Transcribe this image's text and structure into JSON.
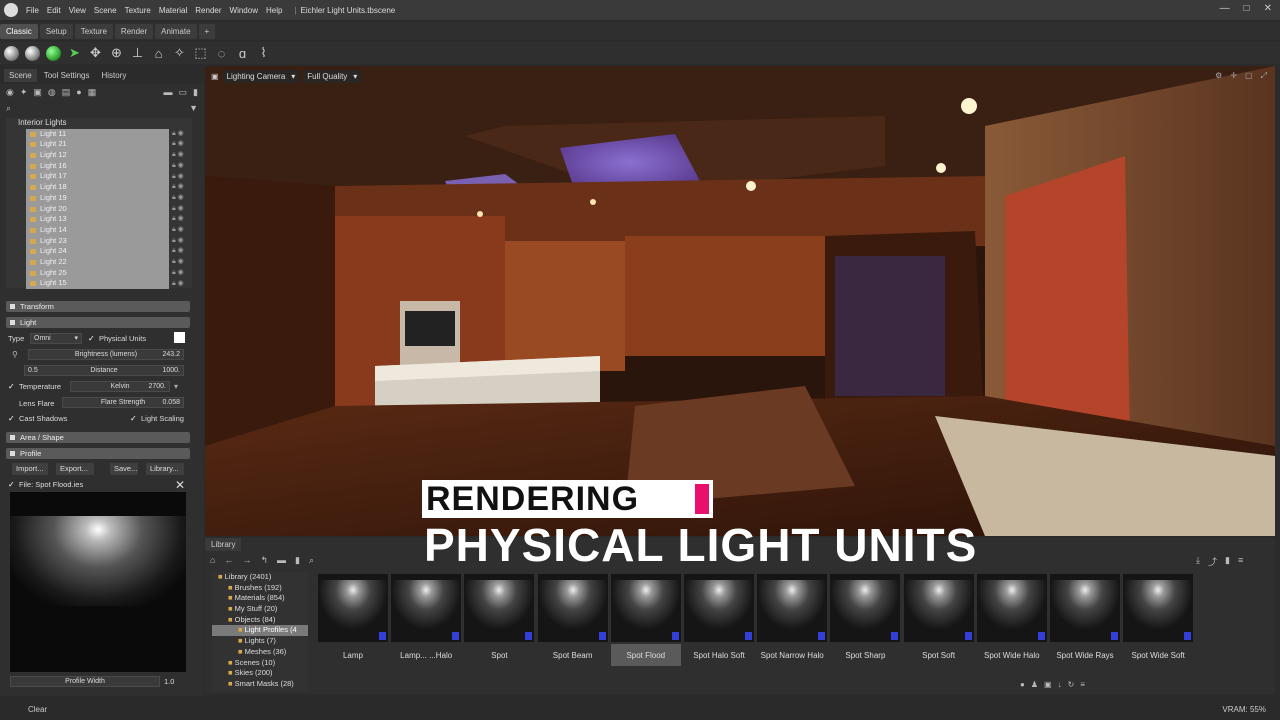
{
  "window": {
    "title": "Eichler Light Units.tbscene",
    "menu": [
      "File",
      "Edit",
      "View",
      "Scene",
      "Texture",
      "Material",
      "Render",
      "Window",
      "Help"
    ],
    "controls": [
      "—",
      "□",
      "✕"
    ]
  },
  "tabs": [
    {
      "label": "Classic",
      "active": true
    },
    {
      "label": "Setup",
      "active": false
    },
    {
      "label": "Texture",
      "active": false
    },
    {
      "label": "Render",
      "active": false
    },
    {
      "label": "Animate",
      "active": false
    },
    {
      "label": "+",
      "active": false
    }
  ],
  "left_panel": {
    "tabs": [
      "Scene",
      "Tool Settings",
      "History"
    ],
    "tree_root": "Interior Lights",
    "tree_items": [
      "Light 11",
      "Light 21",
      "Light 12",
      "Light 16",
      "Light 17",
      "Light 18",
      "Light 19",
      "Light 20",
      "Light 13",
      "Light 14",
      "Light 23",
      "Light 24",
      "Light 22",
      "Light 25",
      "Light 15"
    ],
    "sections": {
      "transform": "Transform",
      "light": "Light",
      "area": "Area / Shape",
      "profile": "Profile"
    },
    "light": {
      "type_label": "Type",
      "type_value": "Omni",
      "physical_units": "Physical Units",
      "brightness_label": "Brightness (lumens)",
      "brightness_value": "243.2",
      "distance_min": "0.5",
      "distance_label": "Distance",
      "distance_value": "1000.",
      "temperature_label": "Temperature",
      "kelvin_label": "Kelvin",
      "kelvin_value": "2700.",
      "lens_flare": "Lens Flare",
      "flare_strength_label": "Flare Strength",
      "flare_strength_value": "0.058",
      "cast_shadows": "Cast Shadows",
      "light_scaling": "Light Scaling"
    },
    "profile": {
      "buttons": [
        "Import...",
        "Export...",
        "Save...",
        "Library..."
      ],
      "file_label": "File: Spot Flood.ies",
      "width_label": "Profile Width",
      "width_value": "1.0"
    }
  },
  "viewport": {
    "camera": "Lighting Camera",
    "quality": "Full Quality"
  },
  "overlay": {
    "line1": "RENDERING",
    "line2": "PHYSICAL LIGHT UNITS",
    "accent": "#e8106b"
  },
  "library": {
    "tab": "Library",
    "tree": [
      {
        "label": "Library (2401)",
        "indent": 0,
        "sel": false
      },
      {
        "label": "Brushes (192)",
        "indent": 1,
        "sel": false
      },
      {
        "label": "Materials (854)",
        "indent": 1,
        "sel": false
      },
      {
        "label": "My Stuff (20)",
        "indent": 1,
        "sel": false
      },
      {
        "label": "Objects (84)",
        "indent": 1,
        "sel": false
      },
      {
        "label": "Light Profiles (4",
        "indent": 2,
        "sel": true
      },
      {
        "label": "Lights (7)",
        "indent": 2,
        "sel": false
      },
      {
        "label": "Meshes (36)",
        "indent": 2,
        "sel": false
      },
      {
        "label": "Scenes (10)",
        "indent": 1,
        "sel": false
      },
      {
        "label": "Skies (200)",
        "indent": 1,
        "sel": false
      },
      {
        "label": "Smart Masks (28)",
        "indent": 1,
        "sel": false
      }
    ],
    "items": [
      {
        "label": "Lamp",
        "active": false
      },
      {
        "label": "Lamp... ...Halo",
        "active": false
      },
      {
        "label": "Spot",
        "active": false
      },
      {
        "label": "Spot Beam",
        "active": false
      },
      {
        "label": "Spot Flood",
        "active": true
      },
      {
        "label": "Spot Halo Soft",
        "active": false
      },
      {
        "label": "Spot Narrow Halo",
        "active": false
      },
      {
        "label": "Spot Sharp",
        "active": false
      },
      {
        "label": "Spot Soft",
        "active": false
      },
      {
        "label": "Spot Wide Halo",
        "active": false
      },
      {
        "label": "Spot Wide Rays",
        "active": false
      },
      {
        "label": "Spot Wide Soft",
        "active": false
      }
    ]
  },
  "status": {
    "clear": "Clear",
    "vram": "VRAM: 55%"
  }
}
